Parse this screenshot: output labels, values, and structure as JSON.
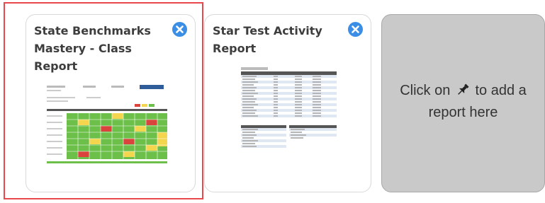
{
  "cards": [
    {
      "title": "State Benchmarks Mastery - Class Report",
      "close_icon": "close-circle-icon",
      "selected": true,
      "thumbnail": "class-report-heatmap-preview"
    },
    {
      "title": "Star Test Activity Report",
      "close_icon": "close-circle-icon",
      "selected": false,
      "thumbnail": "activity-report-table-preview"
    }
  ],
  "placeholder": {
    "text_before": "Click on",
    "icon": "pushpin-icon",
    "text_after": "to add a report here"
  },
  "colors": {
    "accent_blue": "#3a8ee6",
    "selection_red": "#e8474c",
    "placeholder_bg": "#c9c9c9",
    "mastery_green": "#6cc04a",
    "mastery_yellow": "#f3d64e",
    "mastery_red": "#d9443c"
  }
}
